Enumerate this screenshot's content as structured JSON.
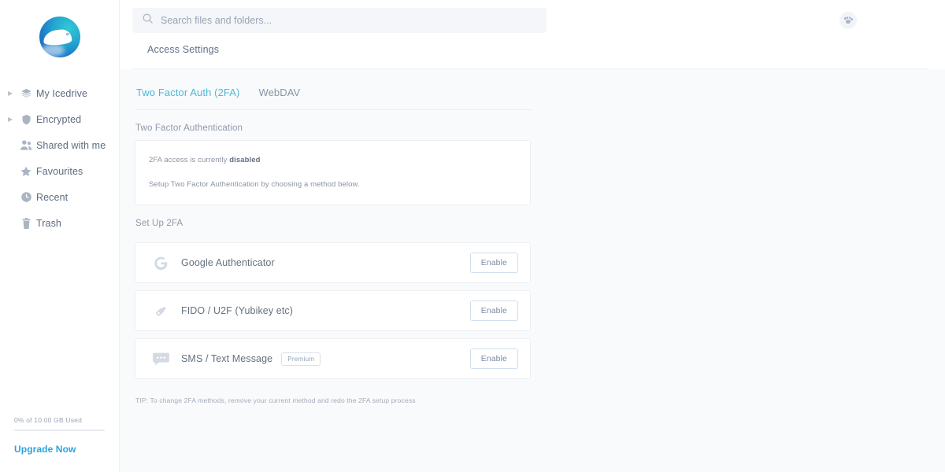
{
  "brand": {
    "logo_name": "icedrive-logo",
    "accent": "#4eb8d8",
    "link_blue": "#29a3e0"
  },
  "sidebar": {
    "items": [
      {
        "label": "My Icedrive",
        "icon": "layers-icon",
        "expandable": true
      },
      {
        "label": "Encrypted",
        "icon": "shield-icon",
        "expandable": true
      },
      {
        "label": "Shared with me",
        "icon": "people-icon",
        "expandable": false
      },
      {
        "label": "Favourites",
        "icon": "star-icon",
        "expandable": false
      },
      {
        "label": "Recent",
        "icon": "clock-icon",
        "expandable": false
      },
      {
        "label": "Trash",
        "icon": "trash-icon",
        "expandable": false
      }
    ],
    "storage": {
      "text": "0% of 10.00 GB Used",
      "percent": 0,
      "upgrade_label": "Upgrade Now"
    }
  },
  "header": {
    "search_placeholder": "Search files and folders...",
    "search_value": "",
    "avatar_icon": "paw-icon",
    "page_title": "Access Settings"
  },
  "tabs": [
    {
      "label": "Two Factor Auth (2FA)",
      "active": true
    },
    {
      "label": "WebDAV",
      "active": false
    }
  ],
  "twofa": {
    "section_title": "Two Factor Authentication",
    "status_prefix": "2FA access is currently ",
    "status_state": "disabled",
    "status_hint": "Setup Two Factor Authentication by choosing a method below.",
    "setup_title": "Set Up 2FA",
    "methods": [
      {
        "label": "Google Authenticator",
        "icon": "google-icon",
        "badge": "",
        "button": "Enable"
      },
      {
        "label": "FIDO / U2F (Yubikey etc)",
        "icon": "usb-key-icon",
        "badge": "",
        "button": "Enable"
      },
      {
        "label": "SMS / Text Message",
        "icon": "chat-bubble-icon",
        "badge": "Premium",
        "button": "Enable"
      }
    ],
    "tip": "TIP: To change 2FA methods, remove your current method and redo the 2FA setup process"
  }
}
